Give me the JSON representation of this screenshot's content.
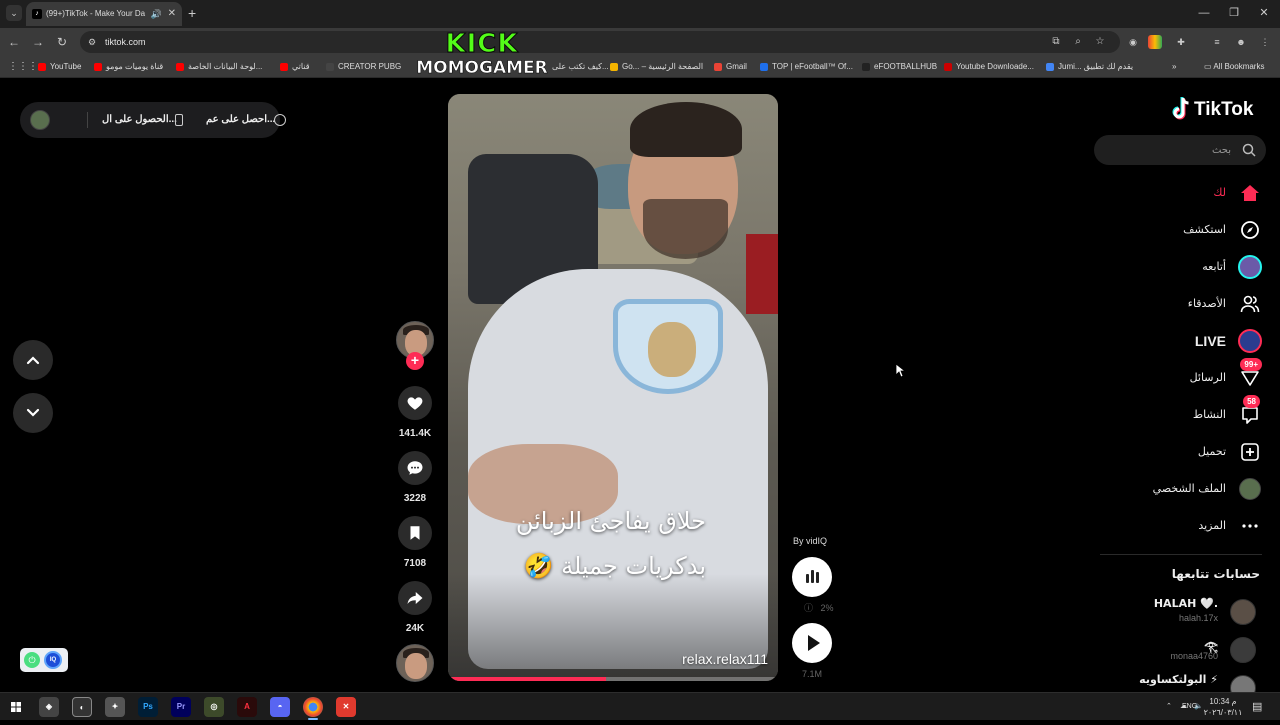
{
  "browser": {
    "tab_title": "(99+)TikTok - Make Your Da",
    "url": "tiktok.com",
    "bookmarks": [
      {
        "label": "YouTube",
        "color": "#ff0000"
      },
      {
        "label": "قناة يوميات مومو",
        "color": "#ff0000"
      },
      {
        "label": "لوحة البيانات الخاصة...",
        "color": "#ff0000"
      },
      {
        "label": "قناتي",
        "color": "#ff0000"
      },
      {
        "label": "CREATOR PUBG",
        "color": "#444444"
      },
      {
        "label": "كيف تكتب على...",
        "color": "#7b2cbf"
      },
      {
        "label": "Go... – الصفحة الرئيسية",
        "color": "#f4b400"
      },
      {
        "label": "Gmail",
        "color": "#ea4335"
      },
      {
        "label": "TOP | eFootball™ Of...",
        "color": "#1f6feb"
      },
      {
        "label": "eFOOTBALLHUB",
        "color": "#222222"
      },
      {
        "label": "Youtube Downloade...",
        "color": "#cc0000"
      },
      {
        "label": "Jumi... يقدم لك تطبيق",
        "color": "#4285f4"
      }
    ],
    "all_bookmarks": "All Bookmarks"
  },
  "overlay": {
    "kick": "KICK",
    "channel": "MOMOGAMER"
  },
  "top_pill": {
    "get_app": "الحصول على ال...",
    "get_web": "احصل على عم..."
  },
  "video": {
    "caption_line1": "حلاق يفاجئ الزبائن",
    "caption_line2": "بدكريات جميلة 🤣",
    "handle": "relax.relax111",
    "progress": 0.48
  },
  "actions": {
    "likes": "141.4K",
    "comments": "3228",
    "saves": "7108",
    "shares": "24K"
  },
  "vidiq": {
    "by": "By vidIQ",
    "percent": "2%",
    "views": "7.1M"
  },
  "sidebar": {
    "logo": "TikTok",
    "search_placeholder": "بحث",
    "nav": [
      {
        "label": "لك",
        "icon": "home-icon"
      },
      {
        "label": "استكشف",
        "icon": "compass-icon"
      },
      {
        "label": "أتابعه",
        "icon": "following-avatar"
      },
      {
        "label": "الأصدقاء",
        "icon": "friends-icon"
      },
      {
        "label": "LIVE",
        "icon": "live-avatar"
      },
      {
        "label": "الرسائل",
        "icon": "messages-icon",
        "badge": "99+"
      },
      {
        "label": "النشاط",
        "icon": "activity-icon",
        "badge": "58"
      },
      {
        "label": "تحميل",
        "icon": "upload-icon"
      },
      {
        "label": "الملف الشخصي",
        "icon": "profile-avatar"
      },
      {
        "label": "المزيد",
        "icon": "more-icon"
      }
    ],
    "following_title": "حسابات تتابعها",
    "accounts": [
      {
        "name": "HALAH 🤍.",
        "user": "halah.17x"
      },
      {
        "name": "𓂀",
        "user": "monaa4760"
      },
      {
        "name": "البولتكساويه ⚡",
        "user": ""
      }
    ]
  },
  "taskbar": {
    "lang": "ENG",
    "time": "10:34 م",
    "date": "٢٠٢٦/٠٣/١١"
  }
}
